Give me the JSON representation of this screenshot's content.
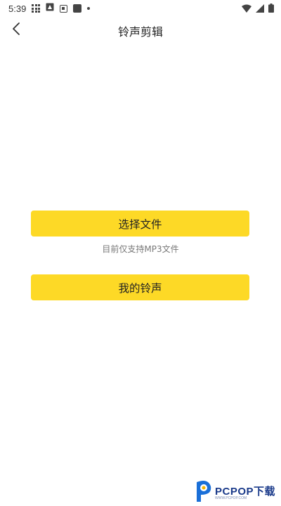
{
  "status_bar": {
    "time": "5:39",
    "icons": [
      "grid-icon",
      "image-icon",
      "screenshot-icon",
      "app-icon",
      "dot-icon"
    ],
    "right_icons": [
      "wifi-icon",
      "signal-icon",
      "battery-icon"
    ]
  },
  "app_bar": {
    "back_icon": "chevron-left-icon",
    "title": "铃声剪辑"
  },
  "main": {
    "select_file_label": "选择文件",
    "hint": "目前仅支持MP3文件",
    "my_ringtones_label": "我的铃声"
  },
  "watermark": {
    "brand": "PCPOP下载",
    "sub": "WWW.PCPOP.COM"
  },
  "colors": {
    "accent": "#fdd926",
    "title": "#222222",
    "hint": "#777777",
    "watermark": "#1a3a8a"
  }
}
